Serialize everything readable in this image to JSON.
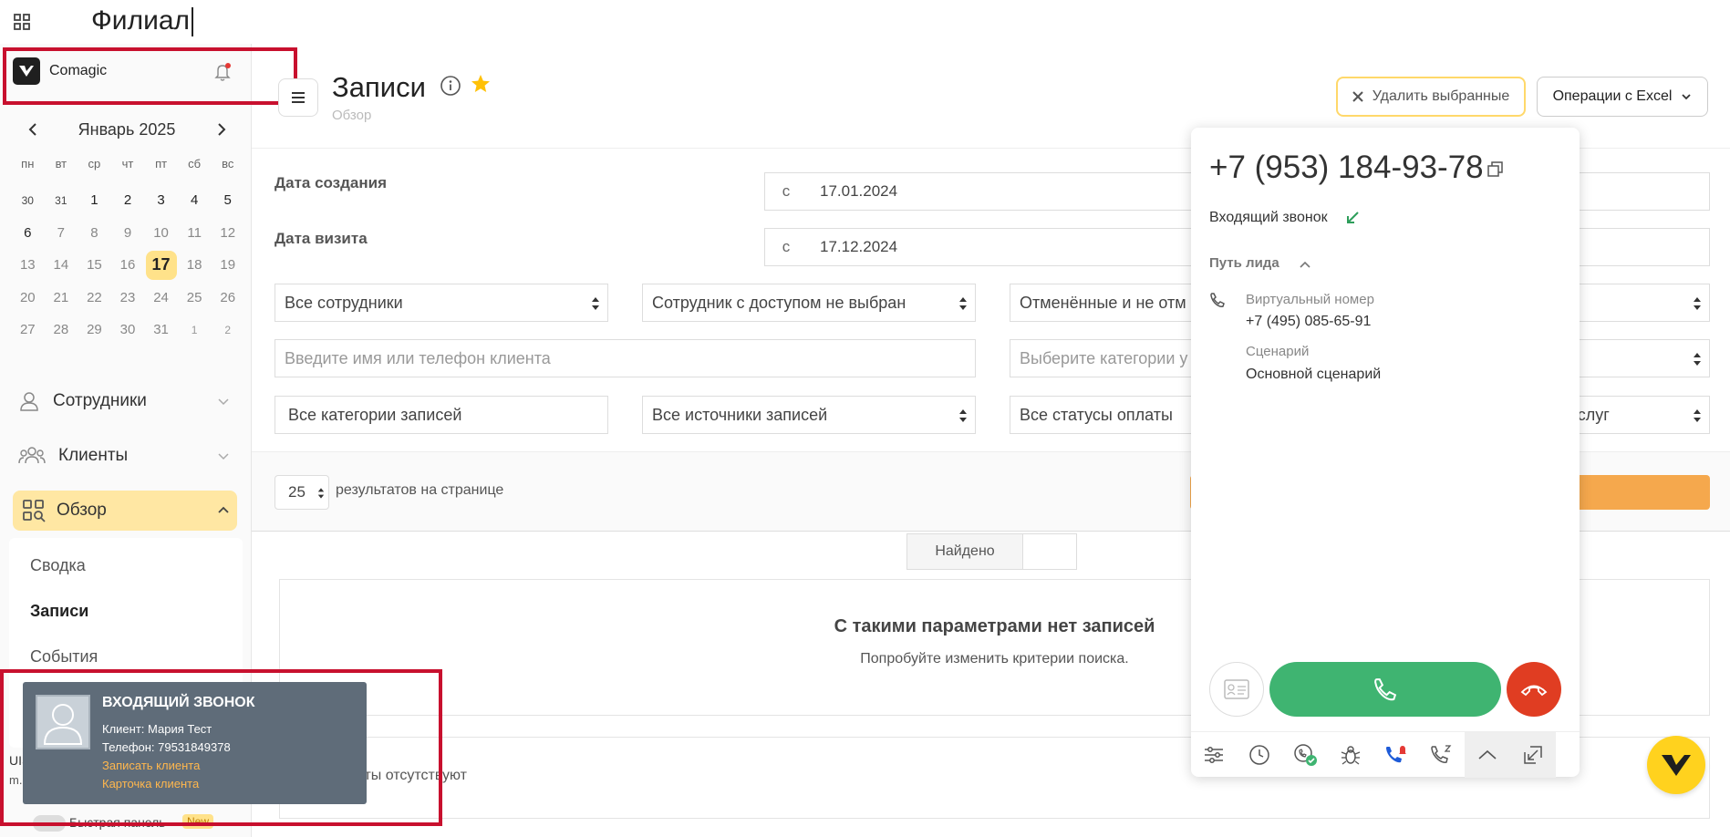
{
  "search": {
    "text": "Филиал"
  },
  "brand": {
    "name": "Comagic"
  },
  "calendar": {
    "title": "Январь 2025",
    "weekdays": [
      "пн",
      "вт",
      "ср",
      "чт",
      "пт",
      "сб",
      "вс"
    ],
    "rows": [
      [
        "30",
        "31",
        "1",
        "2",
        "3",
        "4",
        "5"
      ],
      [
        "6",
        "7",
        "8",
        "9",
        "10",
        "11",
        "12"
      ],
      [
        "13",
        "14",
        "15",
        "16",
        "17",
        "18",
        "19"
      ],
      [
        "20",
        "21",
        "22",
        "23",
        "24",
        "25",
        "26"
      ],
      [
        "27",
        "28",
        "29",
        "30",
        "31",
        "1",
        "2"
      ]
    ],
    "selected_day": "17"
  },
  "nav": {
    "employees": "Сотрудники",
    "clients": "Клиенты",
    "overview": "Обзор",
    "sub": [
      "Сводка",
      "Записи",
      "События"
    ],
    "active_sub": "Записи"
  },
  "user": {
    "org": "UIS/CoMagic",
    "email": "m.nazarov@co"
  },
  "quick_panel": {
    "label": "Быстрая панель",
    "badge": "New"
  },
  "header": {
    "title": "Записи",
    "breadcrumb": "Обзор",
    "delete_label": "Удалить выбранные",
    "excel_label": "Операции с Excel"
  },
  "filters": {
    "created_label": "Дата создания",
    "visit_label": "Дата визита",
    "from_prefix": "с",
    "created_from": "17.01.2024",
    "visit_from": "17.12.2024",
    "employees": "Все сотрудники",
    "access_employee": "Сотрудник с доступом не выбран",
    "cancelled": "Отменённые и не отм",
    "client_placeholder": "Введите имя или телефон клиента",
    "categories_placeholder": "Выберите категории у",
    "record_categories": "Все категории записей",
    "record_sources": "Все источники записей",
    "payment_status": "Все статусы оплаты",
    "services_tail": "услуг"
  },
  "results": {
    "per_page": "25",
    "per_page_label": "результатов на странице",
    "found_label": "Найдено",
    "empty_title": "С такими параметрами нет записей",
    "empty_sub": "Попробуйте изменить критерии поиска.",
    "none": "Результаты отсутствуют"
  },
  "phone": {
    "number": "+7 (953) 184-93-78",
    "call_type": "Входящий звонок",
    "lead_path": "Путь лида",
    "virtual_label": "Виртуальный номер",
    "virtual_number": "+7 (495) 085-65-91",
    "scenario_label": "Сценарий",
    "scenario": "Основной сценарий"
  },
  "notification": {
    "title": "ВХОДЯЩИЙ ЗВОНОК",
    "client": "Клиент: Мария Тест",
    "phone": "Телефон: 79531849378",
    "link_record": "Записать клиента",
    "link_card": "Карточка клиента"
  },
  "colors": {
    "accent_yellow": "#ffe7a3",
    "answer_green": "#3fb471",
    "hangup_red": "#e03d22",
    "highlight_red": "#c8102e",
    "link_orange": "#ffb74d"
  }
}
